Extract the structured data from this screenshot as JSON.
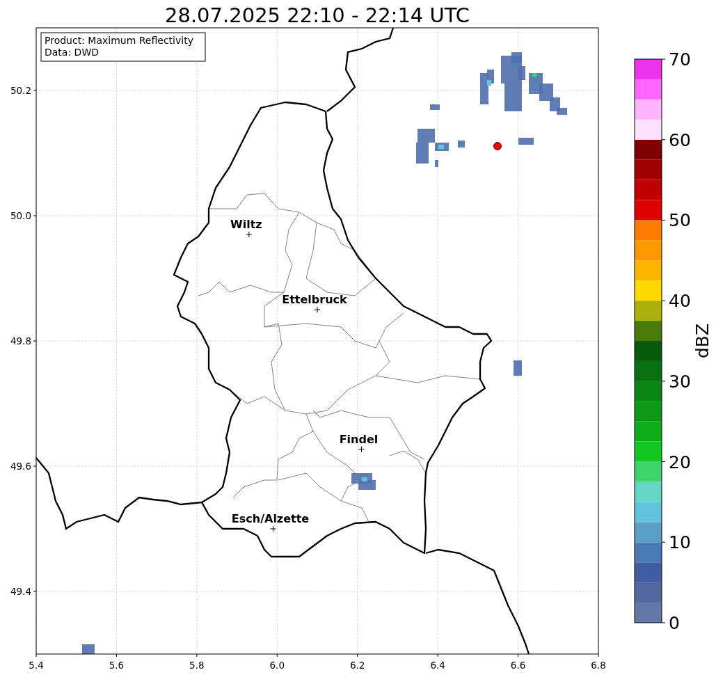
{
  "title": "28.07.2025 22:10 - 22:14 UTC",
  "info_box": {
    "lines": [
      "Product: Maximum Reflectivity",
      "Data: DWD"
    ]
  },
  "map": {
    "chart_data": {
      "type": "scatter",
      "grid": true,
      "xlim": [
        5.4,
        6.8
      ],
      "ylim": [
        49.3,
        50.3
      ],
      "xticks": [
        {
          "value": 5.4,
          "label": "5.4"
        },
        {
          "value": 5.6,
          "label": "5.6"
        },
        {
          "value": 5.8,
          "label": "5.8"
        },
        {
          "value": 6.0,
          "label": "6.0"
        },
        {
          "value": 6.2,
          "label": "6.2"
        },
        {
          "value": 6.4,
          "label": "6.4"
        },
        {
          "value": 6.6,
          "label": "6.6"
        },
        {
          "value": 6.8,
          "label": "6.8"
        }
      ],
      "yticks": [
        {
          "value": 49.4,
          "label": "49.4"
        },
        {
          "value": 49.6,
          "label": "49.6"
        },
        {
          "value": 49.8,
          "label": "49.8"
        },
        {
          "value": 50.0,
          "label": "50.0"
        },
        {
          "value": 50.2,
          "label": "50.2"
        }
      ],
      "x": [
        5.93,
        6.1,
        6.21,
        5.99
      ],
      "series": [
        {
          "color": "#000000",
          "values": [
            49.97,
            49.85,
            49.627,
            49.5
          ]
        }
      ],
      "annotations": [
        {
          "text": "Wiltz",
          "x": 5.93,
          "y": 49.97
        },
        {
          "text": "Ettelbruck",
          "x": 6.1,
          "y": 49.85
        },
        {
          "text": "Findel",
          "x": 6.21,
          "y": 49.627
        },
        {
          "text": "Esch/Alzette",
          "x": 5.99,
          "y": 49.5
        }
      ]
    }
  },
  "colorbar": {
    "label": "dBZ",
    "ticks": [
      "70",
      "60",
      "50",
      "40",
      "30",
      "20",
      "10",
      "0"
    ],
    "bands": [
      {
        "color": "#6478a8"
      },
      {
        "color": "#5468a0"
      },
      {
        "color": "#425ea2"
      },
      {
        "color": "#4a7ab4"
      },
      {
        "color": "#5a9fc8"
      },
      {
        "color": "#62c3dc"
      },
      {
        "color": "#62d8c4"
      },
      {
        "color": "#3ed46c"
      },
      {
        "color": "#12c820"
      },
      {
        "color": "#0eae1a"
      },
      {
        "color": "#0c9a16"
      },
      {
        "color": "#0a8614"
      },
      {
        "color": "#087010"
      },
      {
        "color": "#065c0a"
      },
      {
        "color": "#4a7a08"
      },
      {
        "color": "#aeb00a"
      },
      {
        "color": "#ffd800"
      },
      {
        "color": "#ffb600"
      },
      {
        "color": "#ff9800"
      },
      {
        "color": "#ff7c00"
      },
      {
        "color": "#e00000"
      },
      {
        "color": "#c00000"
      },
      {
        "color": "#a00000"
      },
      {
        "color": "#7e0000"
      },
      {
        "color": "#ffe0ff"
      },
      {
        "color": "#ffb4ff"
      },
      {
        "color": "#ff66ff"
      },
      {
        "color": "#ee33ee"
      }
    ]
  }
}
